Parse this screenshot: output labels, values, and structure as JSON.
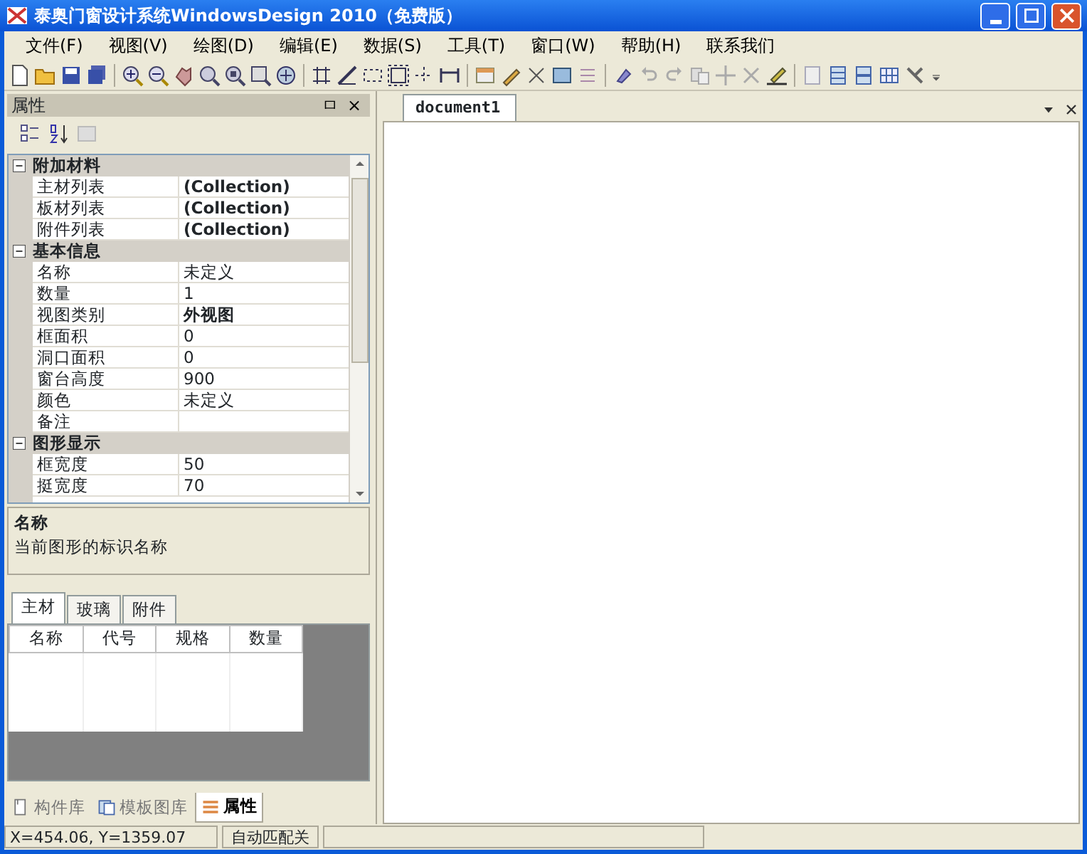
{
  "window": {
    "title": "泰奥门窗设计系统WindowsDesign 2010（免费版）"
  },
  "menu": [
    "文件(F)",
    "视图(V)",
    "绘图(D)",
    "编辑(E)",
    "数据(S)",
    "工具(T)",
    "窗口(W)",
    "帮助(H)",
    "联系我们"
  ],
  "properties_panel": {
    "title": "属性",
    "pin": "ㅁ",
    "close": "×",
    "categories": [
      {
        "name": "附加材料",
        "expanded": true,
        "rows": [
          {
            "name": "主材列表",
            "value": "(Collection)",
            "bold": true
          },
          {
            "name": "板材列表",
            "value": "(Collection)",
            "bold": true
          },
          {
            "name": "附件列表",
            "value": "(Collection)",
            "bold": true
          }
        ]
      },
      {
        "name": "基本信息",
        "expanded": true,
        "rows": [
          {
            "name": "名称",
            "value": "未定义",
            "bold": false
          },
          {
            "name": "数量",
            "value": "1",
            "bold": false
          },
          {
            "name": "视图类别",
            "value": "外视图",
            "bold": true
          },
          {
            "name": "框面积",
            "value": "0",
            "bold": false
          },
          {
            "name": "洞口面积",
            "value": "0",
            "bold": false
          },
          {
            "name": "窗台高度",
            "value": "900",
            "bold": false
          },
          {
            "name": "颜色",
            "value": "未定义",
            "bold": false
          },
          {
            "name": "备注",
            "value": "",
            "bold": false
          }
        ]
      },
      {
        "name": "图形显示",
        "expanded": true,
        "rows": [
          {
            "name": "框宽度",
            "value": "50",
            "bold": false
          },
          {
            "name": "挺宽度",
            "value": "70",
            "bold": false
          }
        ]
      }
    ],
    "description": {
      "title": "名称",
      "text": "当前图形的标识名称"
    }
  },
  "material_tabs": [
    {
      "label": "主材",
      "selected": true
    },
    {
      "label": "玻璃",
      "selected": false
    },
    {
      "label": "附件",
      "selected": false
    }
  ],
  "material_table": {
    "columns": [
      "名称",
      "代号",
      "规格",
      "数量"
    ]
  },
  "bottom_tabs": [
    {
      "label": "构件库",
      "selected": false
    },
    {
      "label": "模板图库",
      "selected": false
    },
    {
      "label": "属性",
      "selected": true
    }
  ],
  "document_tabs": [
    {
      "label": "document1",
      "selected": true
    }
  ],
  "status_bar": [
    "X=454.06, Y=1359.07",
    "自动匹配关"
  ]
}
